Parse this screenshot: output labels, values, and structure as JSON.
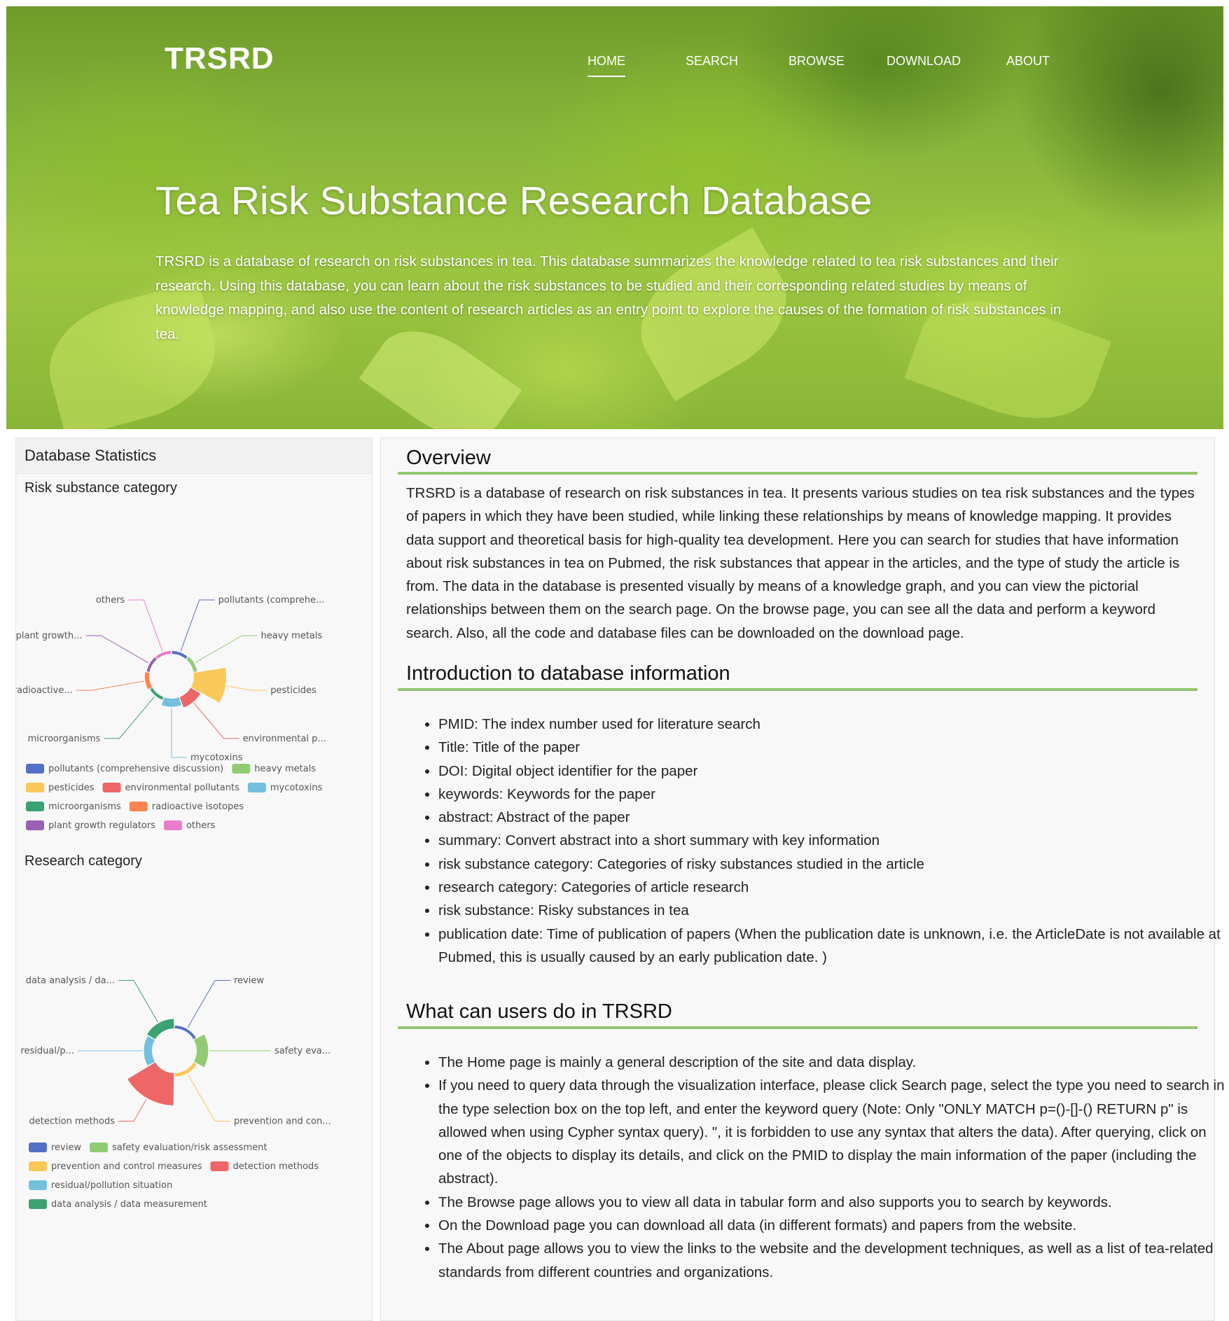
{
  "header": {
    "brand": "TRSRD",
    "nav": [
      "HOME",
      "SEARCH",
      "BROWSE",
      "DOWNLOAD",
      "ABOUT"
    ],
    "active_nav": "HOME",
    "title": "Tea Risk Substance Research Database",
    "description": "TRSRD is a database of research on risk substances in tea. This database summarizes the knowledge related to tea risk substances and their research. Using this database, you can learn about the risk substances to be studied and their corresponding related studies by means of knowledge mapping, and also use the content of research articles as an entry point to explore the causes of the formation of risk substances in tea."
  },
  "stats": {
    "title": "Database Statistics",
    "risk_title": "Risk substance category",
    "research_title": "Research category"
  },
  "chart_data": [
    {
      "type": "pie",
      "title": "Risk substance category",
      "rose": true,
      "categories": [
        "pollutants (comprehensive discussion)",
        "heavy metals",
        "pesticides",
        "environmental pollutants",
        "mycotoxins",
        "microorganisms",
        "radioactive isotopes",
        "plant growth regulators",
        "others"
      ],
      "callout_labels": [
        "pollutants (comprehe...",
        "heavy metals",
        "pesticides",
        "environmental p...",
        "mycotoxins",
        "microorganisms",
        "radioactive...",
        "plant growth...",
        "others"
      ],
      "values": [
        1,
        2,
        40,
        12,
        8,
        1,
        3,
        1,
        1
      ],
      "colors": [
        "#5470c6",
        "#91cc75",
        "#fac858",
        "#ee6666",
        "#73c0de",
        "#3ba272",
        "#fc8452",
        "#9a60b4",
        "#ea7ccc"
      ],
      "legend": "bottom"
    },
    {
      "type": "pie",
      "title": "Research category",
      "rose": true,
      "categories": [
        "review",
        "safety evaluation/risk assessment",
        "prevention and control measures",
        "detection methods",
        "residual/pollution situation",
        "data analysis / data measurement"
      ],
      "callout_labels": [
        "review",
        "safety eva...",
        "prevention and con...",
        "detection methods",
        "residual/p...",
        "data analysis / da..."
      ],
      "values": [
        1,
        14,
        2,
        45,
        9,
        11
      ],
      "colors": [
        "#5470c6",
        "#91cc75",
        "#fac858",
        "#ee6666",
        "#73c0de",
        "#3ba272"
      ],
      "legend": "bottom"
    }
  ],
  "overview": {
    "title": "Overview",
    "text": "TRSRD is a database of research on risk substances in tea. It presents various studies on tea risk substances and the types of papers in which they have been studied, while linking these relationships by means of knowledge mapping. It provides data support and theoretical basis for high-quality tea development. Here you can search for studies that have information about risk substances in tea on Pubmed, the risk substances that appear in the articles, and the type of study the article is from. The data in the database is presented visually by means of a knowledge graph, and you can view the pictorial relationships between them on the search page. On the browse page, you can see all the data and perform a keyword search. Also, all the code and database files can be downloaded on the download page."
  },
  "intro": {
    "title": "Introduction to database information",
    "items": [
      "PMID: The index number used for literature search",
      "Title: Title of the paper",
      "DOI: Digital object identifier for the paper",
      "keywords: Keywords for the paper",
      "abstract: Abstract of the paper",
      "summary: Convert abstract into a short summary with key information",
      "risk substance category: Categories of risky substances studied in the article",
      "research category: Categories of article research",
      "risk substance: Risky substances in tea",
      "publication date: Time of publication of papers (When the publication date is unknown, i.e. the ArticleDate is not available at Pubmed, this is usually caused by an early publication date. )"
    ]
  },
  "users": {
    "title": "What can users do in TRSRD",
    "items": [
      "The Home page is mainly a general description of the site and data display.",
      "If you need to query data through the visualization interface, please click Search page, select the type you need to search in the type selection box on the top left, and enter the keyword query (Note: Only \"ONLY MATCH p=()-[]-() RETURN p\" is allowed when using Cypher syntax query). \", it is forbidden to use any syntax that alters the data). After querying, click on one of the objects to display its details, and click on the PMID to display the main information of the paper (including the abstract).",
      "The Browse page allows you to view all data in tabular form and also supports you to search by keywords.",
      "On the Download page you can download all data (in different formats) and papers from the website.",
      "The About page allows you to view the links to the website and the development techniques, as well as a list of tea-related standards from different countries and organizations."
    ]
  }
}
